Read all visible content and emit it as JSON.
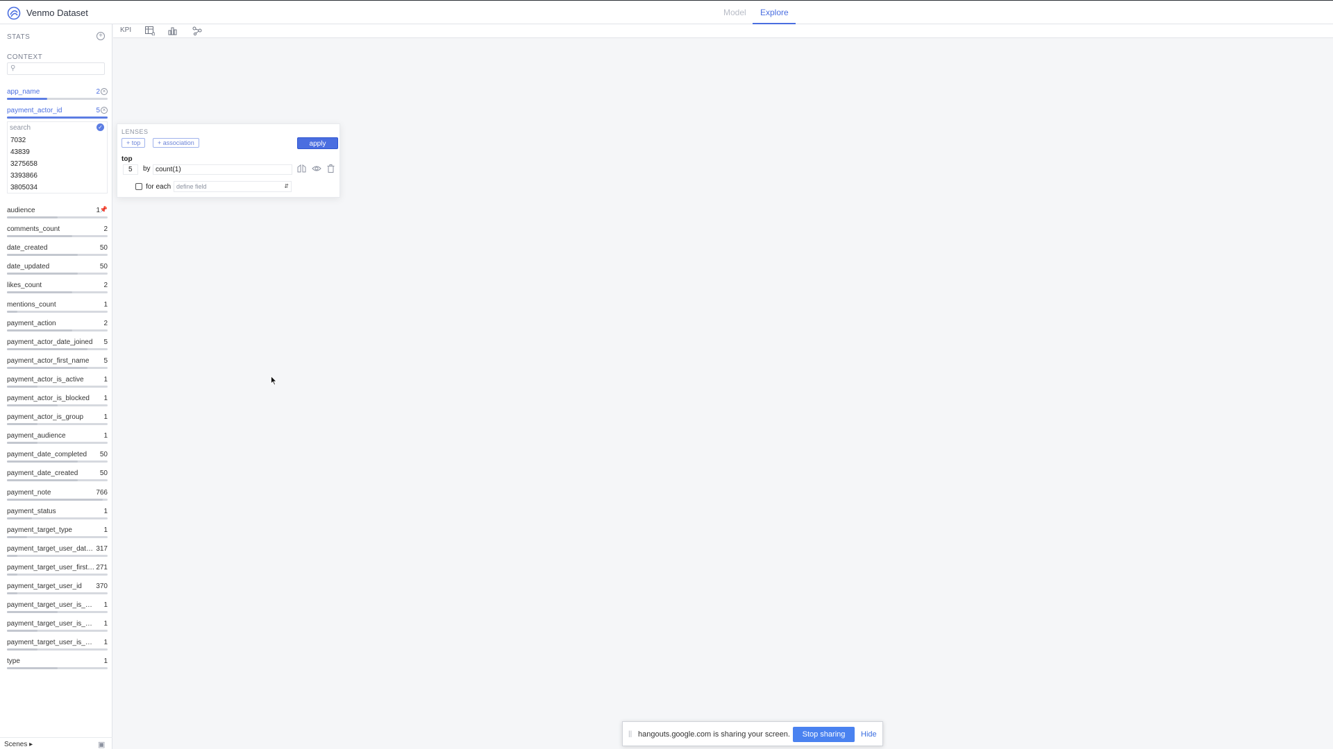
{
  "app": {
    "title": "Venmo Dataset"
  },
  "tabs": [
    {
      "label": "Model"
    },
    {
      "label": "Explore"
    }
  ],
  "colors": {
    "accent": "#4a6ee0",
    "share_button": "#4a82f0"
  },
  "toolbar": {
    "kpi_label": "KPI"
  },
  "sidebar": {
    "stats_label": "STATS",
    "context_label": "CONTEXT",
    "context_fields": [
      {
        "name": "app_name",
        "count": "2",
        "fill": 0.4
      },
      {
        "name": "payment_actor_id",
        "count": "5",
        "fill": 1.0
      }
    ],
    "values_search_placeholder": "search",
    "values": [
      "7032",
      "43839",
      "3275658",
      "3393866",
      "3805034"
    ],
    "fields": [
      {
        "name": "audience",
        "count": "1",
        "fill": 0.5
      },
      {
        "name": "comments_count",
        "count": "2",
        "fill": 0.65
      },
      {
        "name": "date_created",
        "count": "50",
        "fill": 0.7
      },
      {
        "name": "date_updated",
        "count": "50",
        "fill": 0.7
      },
      {
        "name": "likes_count",
        "count": "2",
        "fill": 0.65
      },
      {
        "name": "mentions_count",
        "count": "1",
        "fill": 0.1
      },
      {
        "name": "payment_action",
        "count": "2",
        "fill": 0.65
      },
      {
        "name": "payment_actor_date_joined",
        "count": "5",
        "fill": 0.8
      },
      {
        "name": "payment_actor_first_name",
        "count": "5",
        "fill": 0.8
      },
      {
        "name": "payment_actor_is_active",
        "count": "1",
        "fill": 0.3
      },
      {
        "name": "payment_actor_is_blocked",
        "count": "1",
        "fill": 0.5
      },
      {
        "name": "payment_actor_is_group",
        "count": "1",
        "fill": 0.3
      },
      {
        "name": "payment_audience",
        "count": "1",
        "fill": 0.3
      },
      {
        "name": "payment_date_completed",
        "count": "50",
        "fill": 0.7
      },
      {
        "name": "payment_date_created",
        "count": "50",
        "fill": 0.7
      },
      {
        "name": "payment_note",
        "count": "766",
        "fill": 0.95
      },
      {
        "name": "payment_status",
        "count": "1",
        "fill": 0.25
      },
      {
        "name": "payment_target_type",
        "count": "1",
        "fill": 0.2
      },
      {
        "name": "payment_target_user_date_...",
        "count": "317",
        "fill": 0.1
      },
      {
        "name": "payment_target_user_first_...",
        "count": "271",
        "fill": 0.1
      },
      {
        "name": "payment_target_user_id",
        "count": "370",
        "fill": 0.1
      },
      {
        "name": "payment_target_user_is_active",
        "count": "1",
        "fill": 0.5
      },
      {
        "name": "payment_target_user_is_block...",
        "count": "1",
        "fill": 0.3
      },
      {
        "name": "payment_target_user_is_group",
        "count": "1",
        "fill": 0.3
      },
      {
        "name": "type",
        "count": "1",
        "fill": 0.5
      }
    ],
    "footer_label": "Scenes ▸"
  },
  "lenses": {
    "label": "LENSES",
    "add_top": "+ top",
    "add_association": "+ association",
    "apply_label": "apply",
    "top_label": "top",
    "top_value": "5",
    "by_label": "by",
    "by_value": "count(1)",
    "for_each_label": "for each",
    "define_field_placeholder": "define field"
  },
  "share_bar": {
    "grip": "||",
    "message": "hangouts.google.com is sharing your screen.",
    "stop_label": "Stop sharing",
    "hide_label": "Hide"
  }
}
